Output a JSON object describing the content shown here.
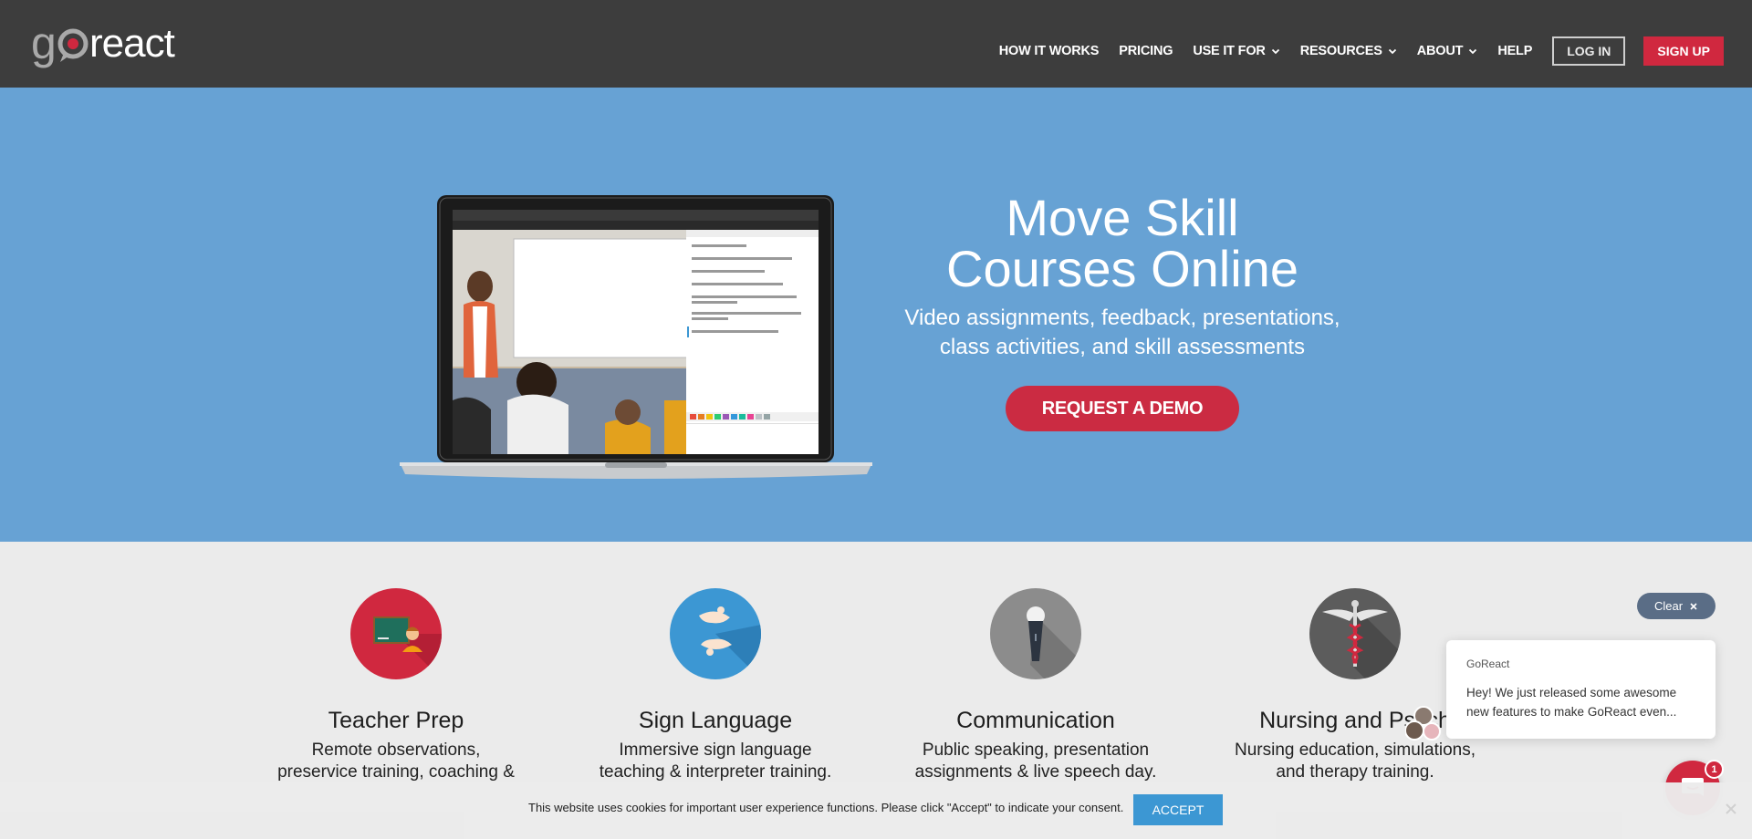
{
  "brand": {
    "logo_text": "goreact",
    "brand_color": "#d0283f"
  },
  "nav": {
    "items": [
      {
        "label": "HOW IT WORKS",
        "dropdown": false
      },
      {
        "label": "PRICING",
        "dropdown": false
      },
      {
        "label": "USE IT FOR",
        "dropdown": true
      },
      {
        "label": "RESOURCES",
        "dropdown": true
      },
      {
        "label": "ABOUT",
        "dropdown": true
      },
      {
        "label": "HELP",
        "dropdown": false
      }
    ],
    "login": "LOG IN",
    "signup": "SIGN UP"
  },
  "hero": {
    "title_line1": "Move Skill",
    "title_line2": "Courses Online",
    "subtitle_line1": "Video assignments, feedback, presentations,",
    "subtitle_line2": "class activities, and skill assessments",
    "cta": "REQUEST A DEMO",
    "background": "#67a2d4"
  },
  "features": [
    {
      "title": "Teacher Prep",
      "line1": "Remote observations,",
      "line2": "preservice training, coaching &",
      "icon": "teacher-chalkboard-icon",
      "color": "#d0283f"
    },
    {
      "title": "Sign Language",
      "line1": "Immersive sign language",
      "line2": "teaching & interpreter training.",
      "icon": "sign-language-hands-icon",
      "color": "#3c97d3"
    },
    {
      "title": "Communication",
      "line1": "Public speaking, presentation",
      "line2": "assignments & live speech day.",
      "icon": "microphone-icon",
      "color": "#8c8c8c"
    },
    {
      "title": "Nursing and Psych",
      "line1": "Nursing education, simulations,",
      "line2": "and therapy training.",
      "icon": "caduceus-icon",
      "color": "#5c5c5c"
    }
  ],
  "chat": {
    "clear_label": "Clear",
    "sender": "GoReact",
    "message_line1": "Hey! We just released some awesome",
    "message_line2": "new features to make GoReact even...",
    "unread_count": "1"
  },
  "cookie": {
    "text": "This website uses cookies for important user experience functions. Please click \"Accept\" to indicate your consent.",
    "accept": "ACCEPT"
  }
}
